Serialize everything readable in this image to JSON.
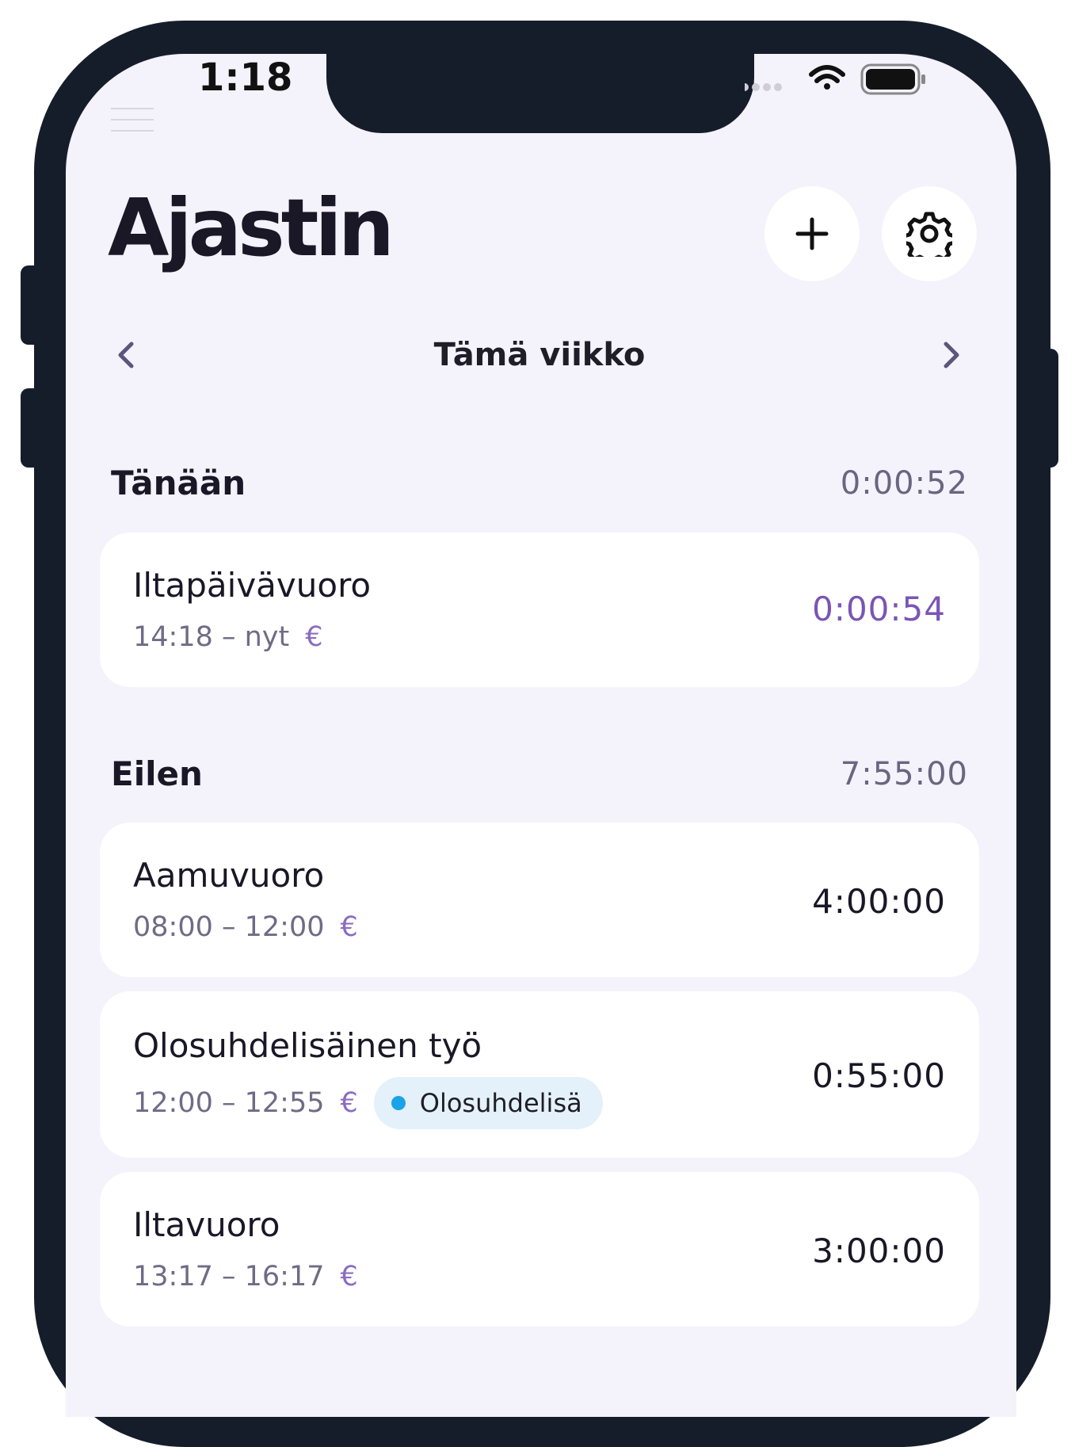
{
  "status_bar": {
    "time": "1:18"
  },
  "header": {
    "title": "Ajastin"
  },
  "week_nav": {
    "label": "Tämä viikko"
  },
  "sections": [
    {
      "label": "Tänään",
      "total": "0:00:52",
      "entries": [
        {
          "title": "Iltapäivävuoro",
          "time_range": "14:18 – nyt",
          "currency": "€",
          "duration": "0:00:54",
          "duration_color": "#7a55b5"
        }
      ]
    },
    {
      "label": "Eilen",
      "total": "7:55:00",
      "entries": [
        {
          "title": "Aamuvuoro",
          "time_range": "08:00 – 12:00",
          "currency": "€",
          "duration": "4:00:00"
        },
        {
          "title": "Olosuhdelisäinen työ",
          "time_range": "12:00 – 12:55",
          "currency": "€",
          "duration": "0:55:00",
          "tag": {
            "label": "Olosuhdelisä",
            "dot_color": "#1aa3e8"
          }
        },
        {
          "title": "Iltavuoro",
          "time_range": "13:17 – 16:17",
          "currency": "€",
          "duration": "3:00:00"
        }
      ]
    }
  ],
  "icons": {
    "menu": "hamburger-icon",
    "add": "plus-icon",
    "settings": "gear-icon",
    "prev": "chevron-left-icon",
    "next": "chevron-right-icon",
    "wifi": "wifi-icon",
    "battery": "battery-icon"
  },
  "colors": {
    "accent": "#7a55b5",
    "background": "#f4f2fb",
    "frame": "#161d2a"
  }
}
